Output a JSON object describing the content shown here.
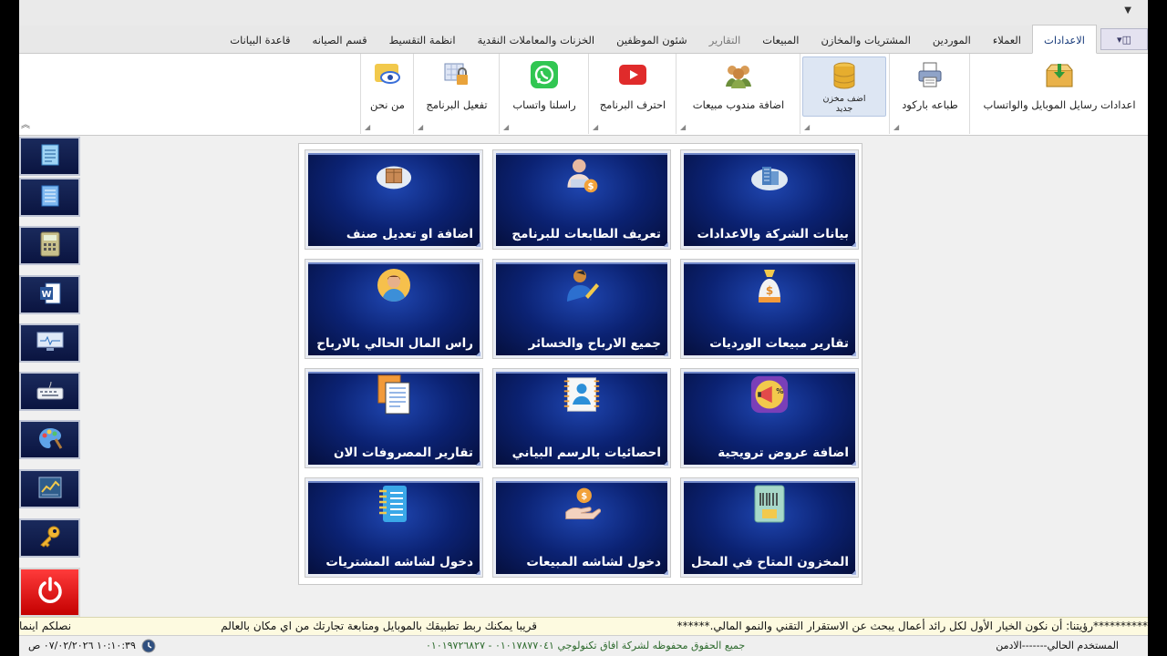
{
  "tabs": [
    {
      "label": "الاعدادات",
      "active": true
    },
    {
      "label": "العملاء"
    },
    {
      "label": "الموردين"
    },
    {
      "label": "المشتريات والمخازن"
    },
    {
      "label": "المبيعات"
    },
    {
      "label": "التقارير",
      "muted": true
    },
    {
      "label": "شئون الموظفين"
    },
    {
      "label": "الخزنات والمعاملات النقدية"
    },
    {
      "label": "انظمة التقسيط"
    },
    {
      "label": "قسم الصيانه"
    },
    {
      "label": "قاعدة البيانات"
    }
  ],
  "ribbon": {
    "mobile_whatsapp_settings": "اعدادات رسايل الموبايل والواتساب",
    "barcode_print": "طباعه باركود",
    "add_store": "اضف مخزن جديد",
    "add_sales_rep": "اضافة مندوب مبيعات",
    "learn_program": "احترف البرنامج",
    "whatsapp_us": "راسلنا واتساب",
    "activate_program": "تفعيل البرنامج",
    "about_us": "من نحن"
  },
  "tiles": [
    {
      "label": "بيانات الشركة والاعدادات",
      "icon": "company-building-icon"
    },
    {
      "label": "تعريف الطابعات للبرنامج",
      "icon": "printer-user-icon"
    },
    {
      "label": "اضافة او تعديل صنف",
      "icon": "product-box-icon"
    },
    {
      "label": "تقارير مبيعات الورديات",
      "icon": "money-bag-icon"
    },
    {
      "label": "جميع الارباح والخسائر",
      "icon": "user-writing-icon"
    },
    {
      "label": "راس المال الحالي بالارباح",
      "icon": "avatar-icon"
    },
    {
      "label": "اضافة عروض ترويجية",
      "icon": "promo-megaphone-icon"
    },
    {
      "label": "احصائيات بالرسم البياني",
      "icon": "id-card-icon"
    },
    {
      "label": "تقارير المصروفات الان",
      "icon": "documents-icon"
    },
    {
      "label": "المخزون المتاح في المحل",
      "icon": "barcode-card-icon"
    },
    {
      "label": "دخول لشاشه المبيعات",
      "icon": "hand-coin-icon"
    },
    {
      "label": "دخول لشاشه المشتريات",
      "icon": "notepad-icon"
    }
  ],
  "side_buttons": [
    "notepad-icon",
    "notes-icon",
    "calculator-icon",
    "word-icon",
    "monitor-icon",
    "keyboard-icon",
    "palette-icon",
    "chart-board-icon",
    "key-icon",
    "power-icon"
  ],
  "ticker": {
    "vision": "**********رؤيتنا: أن نكون الخيار الأول لكل رائد أعمال يبحث عن الاستقرار التقني والنمو المالي.******",
    "soon": "قريبا يمكنك ربط تطبيقك بالموبايل ومتابعة تجارتك من اي مكان بالعالم",
    "cut": "نصلكم اينما"
  },
  "status": {
    "user": "المستخدم الحالي-------الادمن",
    "rights": "جميع الحقوق محفوظه لشركة افاق تكنولوجي  ٠١٠١٧٨٧٧٠٤١ - ٠١٠١٩٧٢٦٨٢٧",
    "datetime": "١٠:١٠:٣٩ ٠٧/٠٢/٢٠٢٦ ص"
  }
}
